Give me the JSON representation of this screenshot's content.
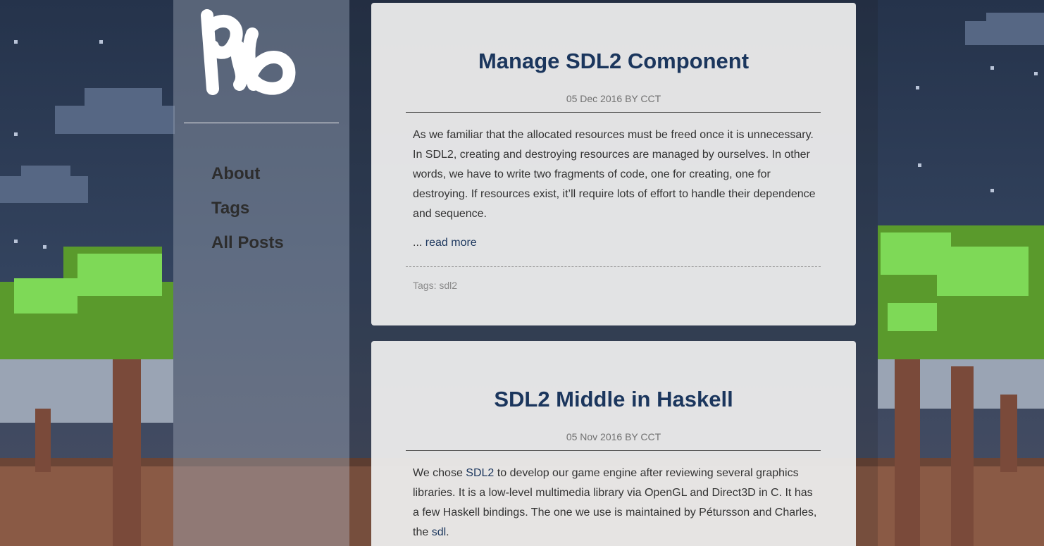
{
  "sidebar": {
    "logo_text": "pb",
    "nav": [
      {
        "label": "About"
      },
      {
        "label": "Tags"
      },
      {
        "label": "All Posts"
      }
    ]
  },
  "posts": [
    {
      "title": "Manage SDL2 Component",
      "meta": "05 Dec 2016 BY CCT",
      "excerpt": "As we familiar that the allocated resources must be freed once it is unnecessary. In SDL2, creating and destroying resources are managed by ourselves. In other words, we have to write two fragments of code, one for creating, one for destroying. If resources exist, it’ll require lots of effort to handle their dependence and sequence.",
      "read_more_prefix": "... ",
      "read_more_label": "read more",
      "tags_label": "Tags:",
      "tags": "sdl2"
    },
    {
      "title": "SDL2 Middle in Haskell",
      "meta": "05 Nov 2016 BY CCT",
      "excerpt_1": "We chose ",
      "link_1": "SDL2",
      "excerpt_2": " to develop our game engine after reviewing several graphics libraries. It is a low-level multimedia library via OpenGL and Direct3D in C. It has a few Haskell bindings. The one we use is maintained by Pétursson and Charles, the ",
      "link_2": "sdl",
      "excerpt_3": "."
    }
  ],
  "colors": {
    "title": "#1b365d",
    "link": "#1b365d",
    "sky": "#2b3a52",
    "foliage": "#7ed957",
    "trunk": "#7a4a3a",
    "ground": "#8a5a45"
  }
}
